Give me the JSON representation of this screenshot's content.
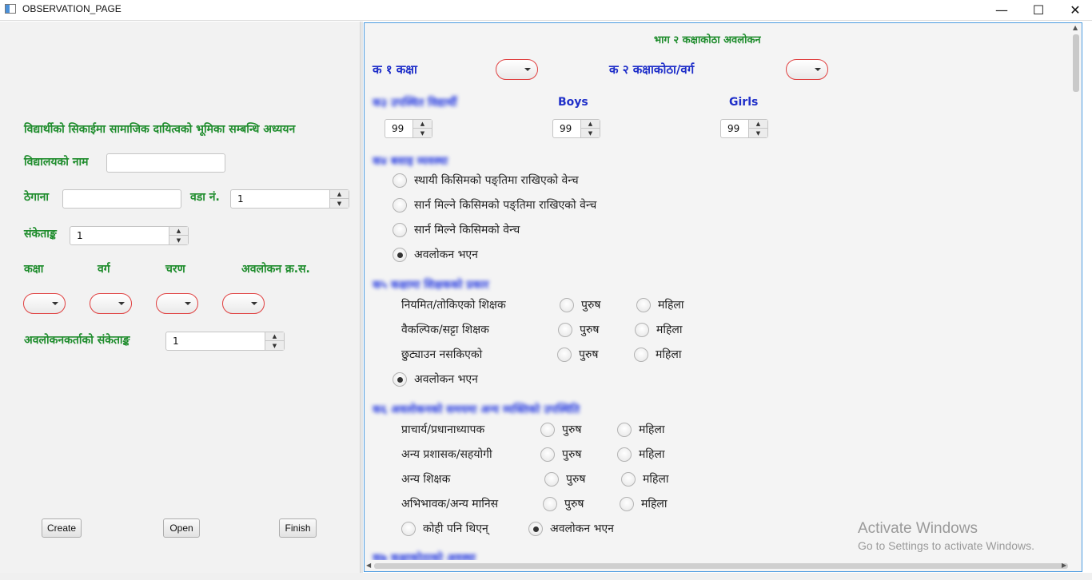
{
  "window": {
    "title": "OBSERVATION_PAGE",
    "minimize": "—",
    "maximize": "☐",
    "close": "✕"
  },
  "left": {
    "study_title": "विद्यार्थीको सिकाईमा सामाजिक दायित्वको भूमिका सम्बन्धि अध्ययन",
    "school_name_label": "विद्यालयको नाम",
    "school_name_value": "",
    "address_label": "ठेगाना",
    "address_value": "",
    "ward_label": "वडा नं.",
    "ward_value": "1",
    "code_label": "संकेताङ्क",
    "code_value": "1",
    "class_label": "कक्षा",
    "section_label": "वर्ग",
    "phase_label": "चरण",
    "obs_serial_label": "अवलोकन क्र.स.",
    "observer_code_label": "अवलोकनकर्ताको संकेताङ्क",
    "observer_code_value": "1",
    "create_button": "Create",
    "open_button": "Open",
    "finish_button": "Finish"
  },
  "right": {
    "section_title": "भाग २ कक्षाकोठा अवलोकन",
    "k1_label": "क १ कक्षा",
    "k2_label": "क २ कक्षाकोठा/वर्ग",
    "students_blurred_label": "क३ उपस्थित विद्यार्थी",
    "total_value": "99",
    "boys_label": "Boys",
    "boys_value": "99",
    "girls_label": "Girls",
    "girls_value": "99",
    "bench_blurred_label": "क४ बसाइ व्यवस्था",
    "bench_options": [
      {
        "label": "स्थायी किसिमको पङ्तिमा राखिएको वेन्च",
        "selected": false
      },
      {
        "label": "सार्न मिल्ने किसिमको पङ्तिमा राखिएको वेन्च",
        "selected": false
      },
      {
        "label": "सार्न मिल्ने किसिमको वेन्च",
        "selected": false
      },
      {
        "label": "अवलोकन भएन",
        "selected": true
      }
    ],
    "teacher_blurred_label": "क५ कक्षामा शिक्षकको प्रकार",
    "teacher_rows": [
      {
        "label": "नियमित/तोकिएको शिक्षक",
        "male": "पुरुष",
        "female": "महिला"
      },
      {
        "label": "वैकल्पिक/सट्टा शिक्षक",
        "male": "पुरुष",
        "female": "महिला"
      },
      {
        "label": "छुट्याउन नसकिएको",
        "male": "पुरुष",
        "female": "महिला"
      }
    ],
    "teacher_not_observed": "अवलोकन भएन",
    "others_blurred_label": "क६ अवलोकनको समयमा अन्य व्यक्तिको उपस्थिति",
    "other_rows": [
      {
        "label": "प्राचार्य/प्रधानाध्यापक",
        "male": "पुरुष",
        "female": "महिला"
      },
      {
        "label": "अन्य प्रशासक/सहयोगी",
        "male": "पुरुष",
        "female": "महिला"
      },
      {
        "label": "अन्य शिक्षक",
        "male": "पुरुष",
        "female": "महिला"
      },
      {
        "label": "अभिभावक/अन्य मानिस",
        "male": "पुरुष",
        "female": "महिला"
      }
    ],
    "nobody_label": "कोही पनि थिएन्",
    "others_not_observed": "अवलोकन भएन",
    "next_blurred_label": "क७ कक्षाकोठाको अवस्था"
  },
  "watermark": {
    "line1": "Activate Windows",
    "line2": "Go to Settings to activate Windows."
  },
  "colors": {
    "green_label": "#1e8c2c",
    "blue_label": "#1f2fc9",
    "combo_border": "#e04040",
    "panel_border": "#4b9be0"
  }
}
